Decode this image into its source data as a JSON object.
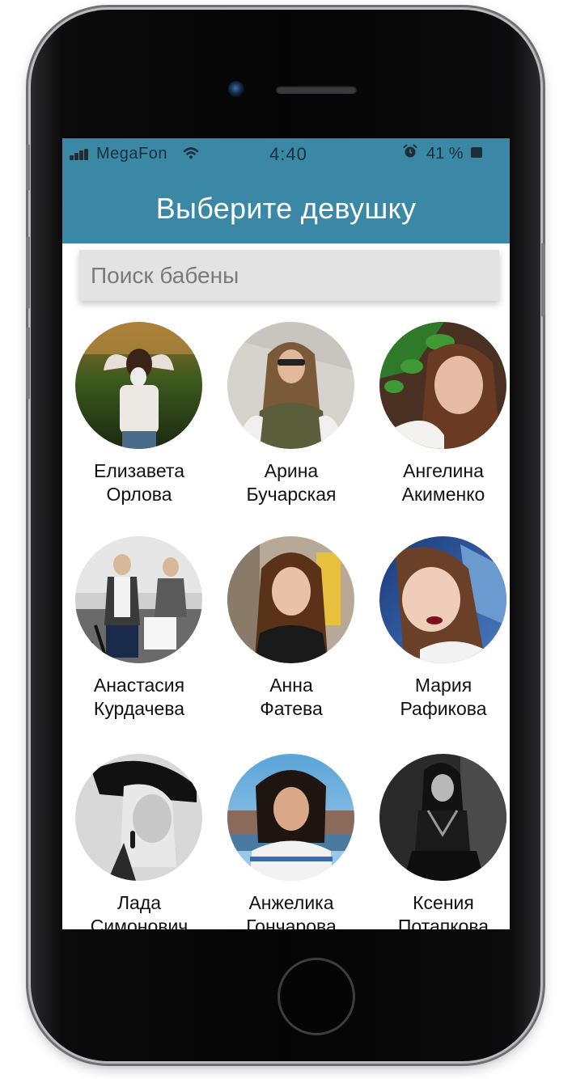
{
  "status_bar": {
    "carrier": "MegaFon",
    "time": "4:40",
    "battery": "41 %"
  },
  "header": {
    "title": "Выберите девушку"
  },
  "search": {
    "placeholder": "Поиск бабены",
    "value": ""
  },
  "profiles": [
    {
      "first": "Елизавета",
      "last": "Орлова"
    },
    {
      "first": "Арина",
      "last": "Бучарская"
    },
    {
      "first": "Ангелина",
      "last": "Акименко"
    },
    {
      "first": "Анастасия",
      "last": "Курдачева"
    },
    {
      "first": "Анна",
      "last": "Фатева"
    },
    {
      "first": "Мария",
      "last": "Рафикова"
    },
    {
      "first": "Лада",
      "last": "Симонович"
    },
    {
      "first": "Анжелика",
      "last": "Гончарова"
    },
    {
      "first": "Ксения",
      "last": "Потапкова"
    }
  ],
  "colors": {
    "header": "#3a88a5",
    "status_text": "#1c2f38",
    "search_bg": "#e3e3e3"
  }
}
